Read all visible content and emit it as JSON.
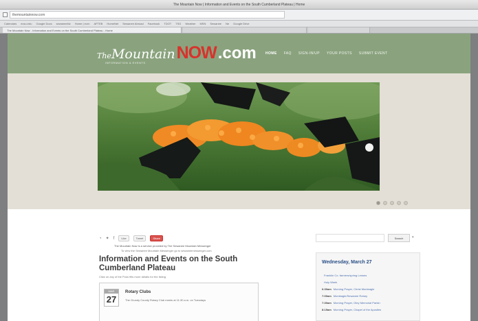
{
  "browser": {
    "window_title": "The Mountain Now | Information and Events on the South Cumberland Plateau | Home",
    "url": "themountainnow.com",
    "bookmarks": [
      "Calendars",
      "ecsu.edu",
      "Google Docs",
      "sewaneebiz",
      "Home | ecrn",
      "AFTEB",
      "HomeNet",
      "Sewanee Abroad",
      "Facebook",
      "TDOT",
      "TSG",
      "Weather",
      "MSN",
      "Sewanee",
      "Ne",
      "Google Drive"
    ],
    "tabs": [
      "The Mountain Now - Information and Events on the South Cumberland Plateau - Home",
      "",
      ""
    ]
  },
  "site": {
    "logo_the": "The",
    "logo_mountain": "Mountain",
    "logo_now": "NOW",
    "logo_com": ".com",
    "tagline": "INFORMATION & EVENTS",
    "nav": [
      "HOME",
      "FAQ",
      "SIGN-IN/UP",
      "YOUR POSTS",
      "SUBMIT EVENT"
    ],
    "accent_color": "#8aa37e",
    "brand_red": "#d8322c"
  },
  "hero": {
    "slide_count": 5,
    "active_slide": 1
  },
  "share": {
    "icons": [
      "rss-icon",
      "twitter-icon",
      "facebook-icon"
    ],
    "like_label": "Like",
    "tweet_label": "Tweet",
    "share_label": "Share"
  },
  "main": {
    "intro_line_1": "The Mountain Now is a service provided by The Sewanee Mountain Messenger",
    "intro_line_2": "To view the Sewanee Mountain Messenger go to sewaneemessenger.com",
    "title": "Information and Events on the South Cumberland Plateau",
    "subnote": "Click on any of the Post-Hits more details for the listing",
    "event": {
      "month": "MAR",
      "day": "27",
      "title": "Rotary Clubs",
      "desc": "The Grundy County Rotary Club meets at 11:30 a.m. on Tuesdays"
    }
  },
  "sidebar": {
    "search_placeholder": "",
    "search_button": "Search",
    "calendar_heading": "Wednesday, March 27",
    "calendar_items": [
      {
        "time": "",
        "text": "Franklin Co. farmers/spring Lenses"
      },
      {
        "time": "",
        "text": "Holy Week"
      },
      {
        "time": "6:30am",
        "text": "Morning Prayer, Christ Monteagle"
      },
      {
        "time": "7:00am",
        "text": "Monteagle/Sewanee Rotary"
      },
      {
        "time": "7:30am",
        "text": "Morning Prayer, Otey Memorial Parish"
      },
      {
        "time": "8:15am",
        "text": "Morning Prayer, Chapel of the Apostles"
      }
    ]
  }
}
